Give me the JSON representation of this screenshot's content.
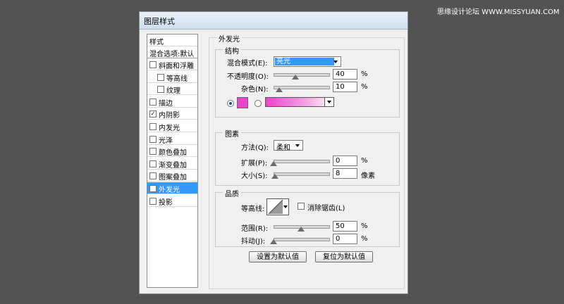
{
  "watermark": "思缘设计论坛 WWW.MISSYUAN.COM",
  "dialog": {
    "title": "图层样式"
  },
  "left_panel": {
    "header": "样式",
    "blend_options": "混合选项:默认",
    "items": [
      {
        "label": "斜面和浮雕",
        "checked": false,
        "indent": 0
      },
      {
        "label": "等高线",
        "checked": false,
        "indent": 1
      },
      {
        "label": "纹理",
        "checked": false,
        "indent": 1
      },
      {
        "label": "描边",
        "checked": false,
        "indent": 0
      },
      {
        "label": "内阴影",
        "checked": true,
        "indent": 0
      },
      {
        "label": "内发光",
        "checked": false,
        "indent": 0
      },
      {
        "label": "光泽",
        "checked": false,
        "indent": 0
      },
      {
        "label": "颜色叠加",
        "checked": false,
        "indent": 0
      },
      {
        "label": "渐变叠加",
        "checked": false,
        "indent": 0
      },
      {
        "label": "图案叠加",
        "checked": false,
        "indent": 0
      },
      {
        "label": "外发光",
        "checked": true,
        "indent": 0
      },
      {
        "label": "投影",
        "checked": false,
        "indent": 0
      }
    ],
    "check_mark": "✓"
  },
  "outer_glow": {
    "title": "外发光",
    "structure": {
      "title": "结构",
      "blend_mode_label": "混合模式(E):",
      "blend_mode_value": "亮光",
      "opacity_label": "不透明度(O):",
      "opacity_value": "40",
      "opacity_unit": "%",
      "noise_label": "杂色(N):",
      "noise_value": "10",
      "noise_unit": "%",
      "opacity_level": 0.4,
      "noise_level": 0.1,
      "color_swatch": "#ee44cc"
    },
    "elements": {
      "title": "图素",
      "technique_label": "方法(Q):",
      "technique_value": "柔和",
      "spread_label": "扩展(P):",
      "spread_value": "0",
      "spread_unit": "%",
      "size_label": "大小(S):",
      "size_value": "8",
      "size_unit": "像素",
      "spread_level": 0,
      "size_level": 0.03
    },
    "quality": {
      "title": "品质",
      "contour_label": "等高线:",
      "antialias_label": "消除锯齿(L)",
      "range_label": "范围(R):",
      "range_value": "50",
      "range_unit": "%",
      "jitter_label": "抖动(J):",
      "jitter_value": "0",
      "jitter_unit": "%",
      "range_level": 0.5,
      "jitter_level": 0
    },
    "buttons": {
      "make_default": "设置为默认值",
      "reset_default": "复位为默认值"
    }
  }
}
